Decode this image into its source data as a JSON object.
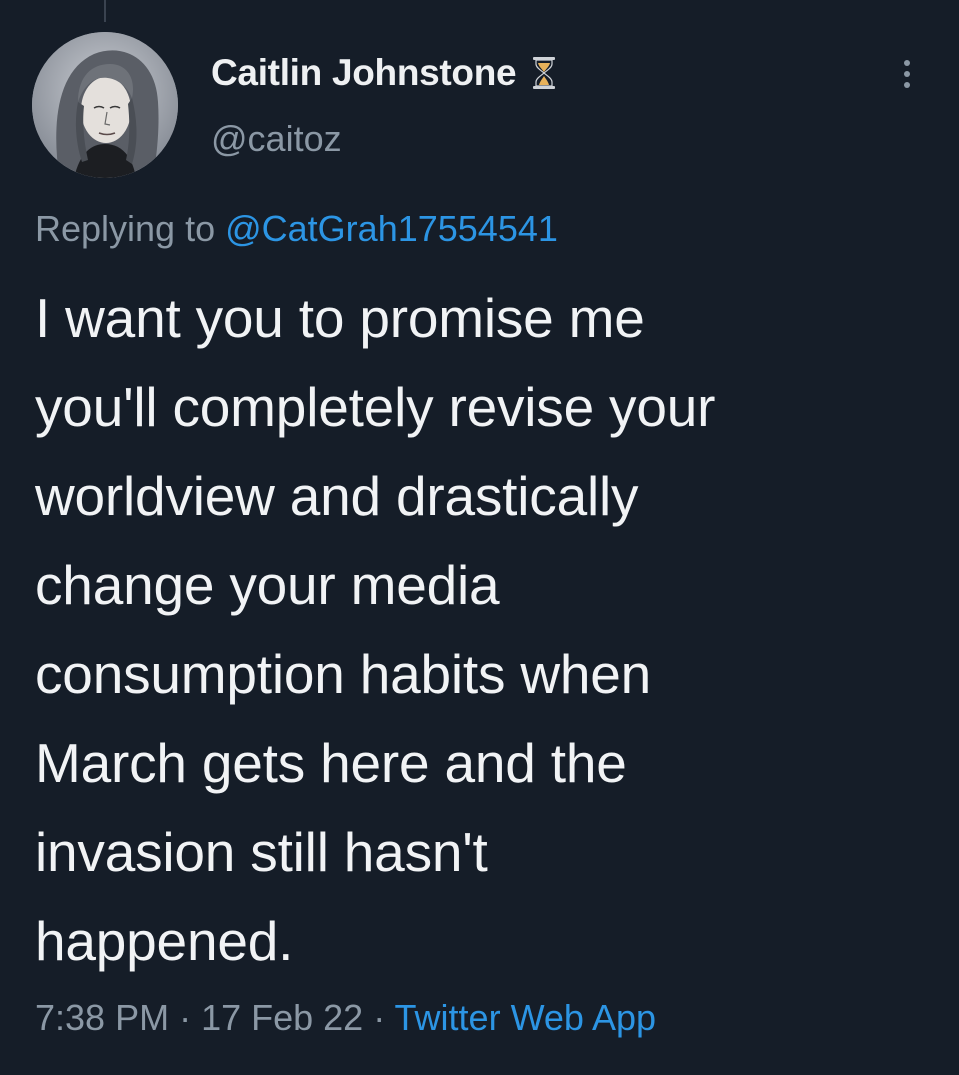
{
  "author": {
    "display_name": "Caitlin Johnstone",
    "handle": "@caitoz",
    "avatar_icon": "portrait-avatar",
    "badge_icon": "hourglass-icon"
  },
  "reply": {
    "prefix": "Replying to ",
    "to_handle": "@CatGrah17554541"
  },
  "tweet": {
    "text": "I want you to promise me\nyou'll completely revise your\nworldview and drastically\nchange your media\nconsumption habits when\nMarch gets here and the\ninvasion still hasn't\nhappened."
  },
  "meta": {
    "time": "7:38 PM",
    "separator": " · ",
    "date": "17 Feb 22",
    "source": "Twitter Web App"
  },
  "menu": {
    "icon": "more-vertical-icon"
  },
  "colors": {
    "background": "#151d28",
    "text": "#e7e9ea",
    "secondary_text": "#8b98a5",
    "link": "#2c95e4",
    "badge": "#e8b25a"
  }
}
